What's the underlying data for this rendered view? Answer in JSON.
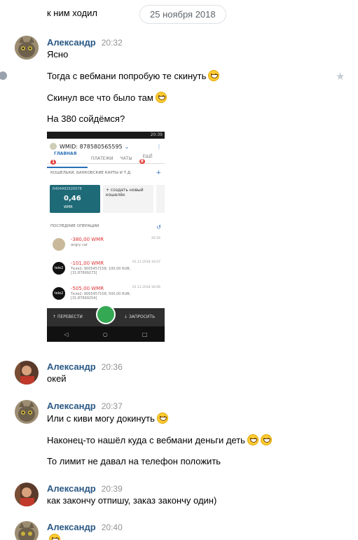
{
  "top": {
    "prev_text": "к ним ходил",
    "date": "25 ноября 2018"
  },
  "groups": [
    {
      "author": "Александр",
      "time": "20:32",
      "messages": [
        "Ясно",
        "Тогда с вебмани попробую те скинуть",
        "Скинул все что было там",
        "На 380 сойдёмся?"
      ]
    },
    {
      "author": "Александр",
      "time": "20:36",
      "messages": [
        "окей"
      ]
    },
    {
      "author": "Александр",
      "time": "20:37",
      "messages": [
        "Или с киви могу докинуть",
        "Наконец-то нашёл куда с вебмани деньги деть",
        "То лимит не давал на телефон положить"
      ]
    },
    {
      "author": "Александр",
      "time": "20:39",
      "messages": [
        "как закончу отпишу, заказ закончу один)"
      ]
    },
    {
      "author": "Александр",
      "time": "20:40",
      "messages": []
    }
  ],
  "phone": {
    "status_time": "20:39",
    "wmid": "WMID: 878580565595",
    "tabs": [
      "ГЛАВНАЯ",
      "ПЛАТЕЖИ",
      "ЧАТЫ",
      "ЕЩЁ"
    ],
    "tab_badges": [
      "1",
      "",
      "",
      "8"
    ],
    "section_wallets": "КОШЕЛЬКИ, БАНКОВСКИЕ КАРТЫ И Т.Д.",
    "wallet_id": "R404492920078",
    "wallet_amount": "0,46",
    "wallet_currency": "WMR",
    "new_wallet": "+ создать новый кошелёк",
    "section_ops": "ПОСЛЕДНИЕ ОПЕРАЦИИ",
    "ops": [
      {
        "amount": "-380,00 WMR",
        "sub": "angry cat",
        "date": "20:34",
        "icon": ""
      },
      {
        "amount": "-101,00 WMR",
        "sub": "Теле2: 9005457158; 100,00 RUB; [31:87699273]",
        "date": "01.11.2018 16:07",
        "icon": "tele2"
      },
      {
        "amount": "-505,00 WMR",
        "sub": "Теле2: 9005457158; 500,00 RUB; [31:87699254]",
        "date": "01.11.2018 16:06",
        "icon": "tele2"
      }
    ],
    "btn_send": "ПЕРЕВЕСТИ",
    "btn_request": "ЗАПРОСИТЬ"
  }
}
